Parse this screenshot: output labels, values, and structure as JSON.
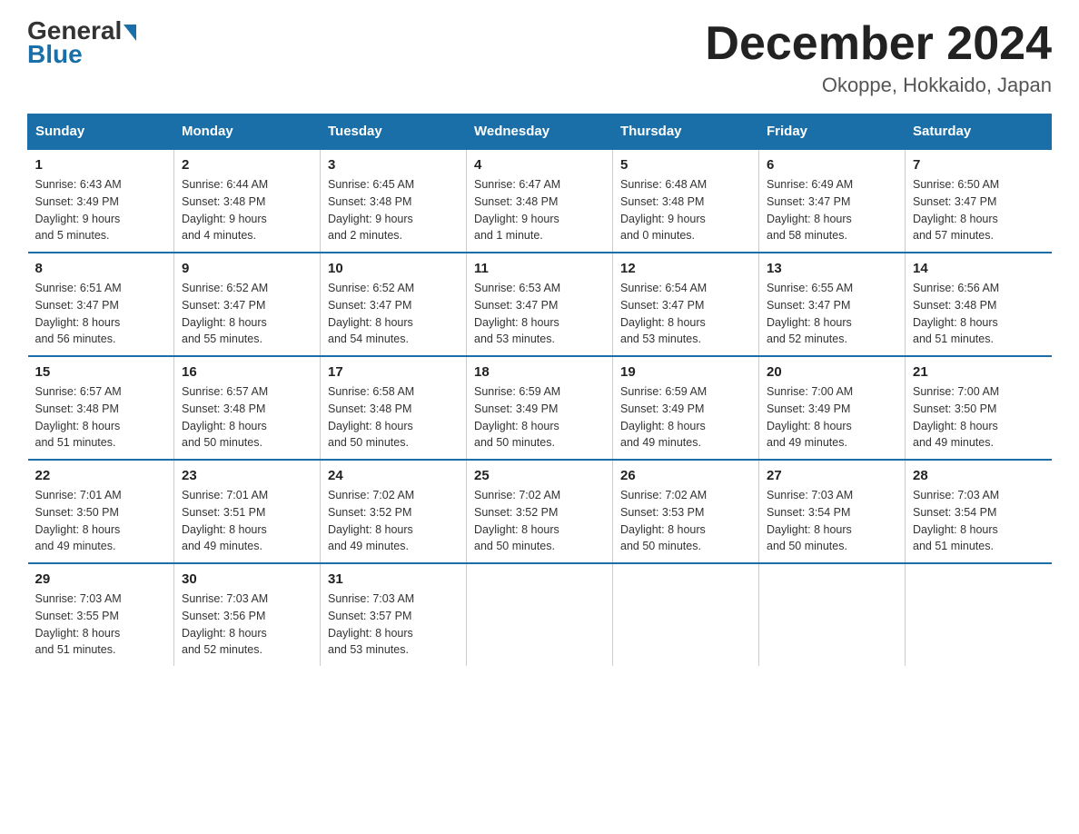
{
  "header": {
    "logo_general": "General",
    "logo_blue": "Blue",
    "month_title": "December 2024",
    "location": "Okoppe, Hokkaido, Japan"
  },
  "days_of_week": [
    "Sunday",
    "Monday",
    "Tuesday",
    "Wednesday",
    "Thursday",
    "Friday",
    "Saturday"
  ],
  "weeks": [
    [
      {
        "day": "1",
        "sunrise": "6:43 AM",
        "sunset": "3:49 PM",
        "daylight": "9 hours and 5 minutes."
      },
      {
        "day": "2",
        "sunrise": "6:44 AM",
        "sunset": "3:48 PM",
        "daylight": "9 hours and 4 minutes."
      },
      {
        "day": "3",
        "sunrise": "6:45 AM",
        "sunset": "3:48 PM",
        "daylight": "9 hours and 2 minutes."
      },
      {
        "day": "4",
        "sunrise": "6:47 AM",
        "sunset": "3:48 PM",
        "daylight": "9 hours and 1 minute."
      },
      {
        "day": "5",
        "sunrise": "6:48 AM",
        "sunset": "3:48 PM",
        "daylight": "9 hours and 0 minutes."
      },
      {
        "day": "6",
        "sunrise": "6:49 AM",
        "sunset": "3:47 PM",
        "daylight": "8 hours and 58 minutes."
      },
      {
        "day": "7",
        "sunrise": "6:50 AM",
        "sunset": "3:47 PM",
        "daylight": "8 hours and 57 minutes."
      }
    ],
    [
      {
        "day": "8",
        "sunrise": "6:51 AM",
        "sunset": "3:47 PM",
        "daylight": "8 hours and 56 minutes."
      },
      {
        "day": "9",
        "sunrise": "6:52 AM",
        "sunset": "3:47 PM",
        "daylight": "8 hours and 55 minutes."
      },
      {
        "day": "10",
        "sunrise": "6:52 AM",
        "sunset": "3:47 PM",
        "daylight": "8 hours and 54 minutes."
      },
      {
        "day": "11",
        "sunrise": "6:53 AM",
        "sunset": "3:47 PM",
        "daylight": "8 hours and 53 minutes."
      },
      {
        "day": "12",
        "sunrise": "6:54 AM",
        "sunset": "3:47 PM",
        "daylight": "8 hours and 53 minutes."
      },
      {
        "day": "13",
        "sunrise": "6:55 AM",
        "sunset": "3:47 PM",
        "daylight": "8 hours and 52 minutes."
      },
      {
        "day": "14",
        "sunrise": "6:56 AM",
        "sunset": "3:48 PM",
        "daylight": "8 hours and 51 minutes."
      }
    ],
    [
      {
        "day": "15",
        "sunrise": "6:57 AM",
        "sunset": "3:48 PM",
        "daylight": "8 hours and 51 minutes."
      },
      {
        "day": "16",
        "sunrise": "6:57 AM",
        "sunset": "3:48 PM",
        "daylight": "8 hours and 50 minutes."
      },
      {
        "day": "17",
        "sunrise": "6:58 AM",
        "sunset": "3:48 PM",
        "daylight": "8 hours and 50 minutes."
      },
      {
        "day": "18",
        "sunrise": "6:59 AM",
        "sunset": "3:49 PM",
        "daylight": "8 hours and 50 minutes."
      },
      {
        "day": "19",
        "sunrise": "6:59 AM",
        "sunset": "3:49 PM",
        "daylight": "8 hours and 49 minutes."
      },
      {
        "day": "20",
        "sunrise": "7:00 AM",
        "sunset": "3:49 PM",
        "daylight": "8 hours and 49 minutes."
      },
      {
        "day": "21",
        "sunrise": "7:00 AM",
        "sunset": "3:50 PM",
        "daylight": "8 hours and 49 minutes."
      }
    ],
    [
      {
        "day": "22",
        "sunrise": "7:01 AM",
        "sunset": "3:50 PM",
        "daylight": "8 hours and 49 minutes."
      },
      {
        "day": "23",
        "sunrise": "7:01 AM",
        "sunset": "3:51 PM",
        "daylight": "8 hours and 49 minutes."
      },
      {
        "day": "24",
        "sunrise": "7:02 AM",
        "sunset": "3:52 PM",
        "daylight": "8 hours and 49 minutes."
      },
      {
        "day": "25",
        "sunrise": "7:02 AM",
        "sunset": "3:52 PM",
        "daylight": "8 hours and 50 minutes."
      },
      {
        "day": "26",
        "sunrise": "7:02 AM",
        "sunset": "3:53 PM",
        "daylight": "8 hours and 50 minutes."
      },
      {
        "day": "27",
        "sunrise": "7:03 AM",
        "sunset": "3:54 PM",
        "daylight": "8 hours and 50 minutes."
      },
      {
        "day": "28",
        "sunrise": "7:03 AM",
        "sunset": "3:54 PM",
        "daylight": "8 hours and 51 minutes."
      }
    ],
    [
      {
        "day": "29",
        "sunrise": "7:03 AM",
        "sunset": "3:55 PM",
        "daylight": "8 hours and 51 minutes."
      },
      {
        "day": "30",
        "sunrise": "7:03 AM",
        "sunset": "3:56 PM",
        "daylight": "8 hours and 52 minutes."
      },
      {
        "day": "31",
        "sunrise": "7:03 AM",
        "sunset": "3:57 PM",
        "daylight": "8 hours and 53 minutes."
      },
      {
        "day": "",
        "sunrise": "",
        "sunset": "",
        "daylight": ""
      },
      {
        "day": "",
        "sunrise": "",
        "sunset": "",
        "daylight": ""
      },
      {
        "day": "",
        "sunrise": "",
        "sunset": "",
        "daylight": ""
      },
      {
        "day": "",
        "sunrise": "",
        "sunset": "",
        "daylight": ""
      }
    ]
  ]
}
